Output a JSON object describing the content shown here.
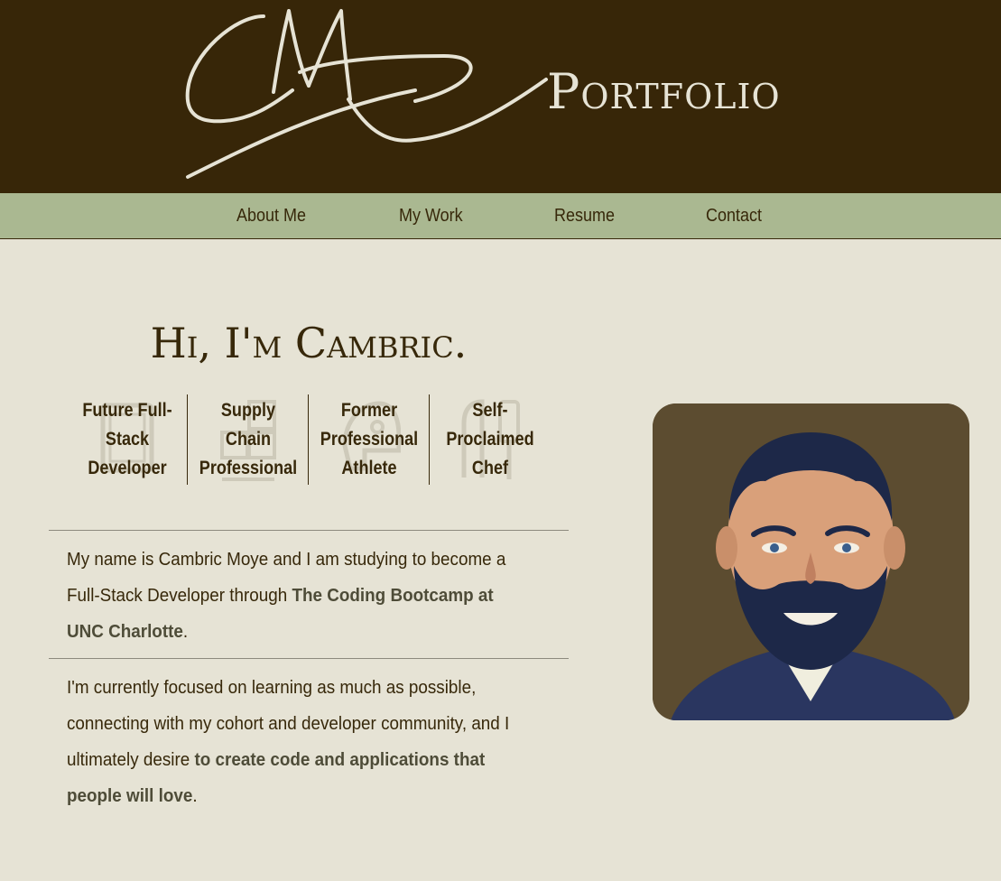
{
  "header": {
    "title": "Portfolio",
    "logo_icon": "signature-logo",
    "bg_color": "#372608",
    "text_color": "#e6e3d5"
  },
  "nav": {
    "items": [
      {
        "label": "About Me"
      },
      {
        "label": "My Work"
      },
      {
        "label": "Resume"
      },
      {
        "label": "Contact"
      }
    ],
    "bg_color": "#aab891"
  },
  "main": {
    "greeting": "Hi, I'm Cambric.",
    "roles": [
      {
        "label": "Future Full-Stack Developer",
        "icon": "laptop-icon"
      },
      {
        "label": "Supply Chain Professional",
        "icon": "boxes-icon"
      },
      {
        "label": "Former Professional Athlete",
        "icon": "helmet-icon"
      },
      {
        "label": "Self-Proclaimed Chef",
        "icon": "kitchen-utensils-icon"
      }
    ],
    "paragraph1": {
      "text": "My name is Cambric Moye and I am studying to become a Full-Stack Developer through ",
      "highlight": "The Coding Bootcamp at UNC Charlotte",
      "end": "."
    },
    "paragraph2": {
      "text": "I'm currently focused on learning as much as possible, connecting with my cohort and developer community, and I ultimately desire ",
      "highlight": "to create code and applications that people will love",
      "end": "."
    },
    "avatar_icon": "profile-portrait",
    "bg_color": "#e6e3d5"
  }
}
